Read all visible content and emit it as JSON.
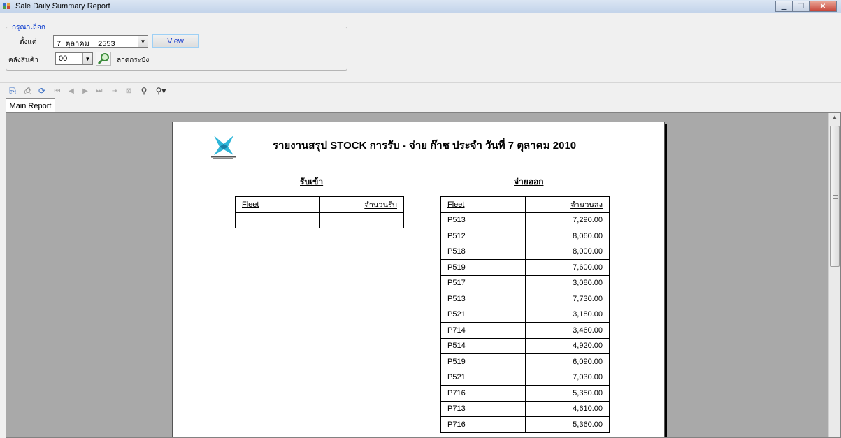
{
  "window": {
    "title": "Sale Daily Summary Report"
  },
  "filter": {
    "group_label": "กรุณาเลือก",
    "from_label": "ตั้งแต่",
    "date_value": "7  ตุลาคม    2553",
    "view_button": "View",
    "warehouse_label": "คลังสินค้า",
    "warehouse_code": "00",
    "warehouse_name": "ลาดกระบัง"
  },
  "tabs": [
    "Main Report"
  ],
  "report": {
    "title": "รายงานสรุป STOCK การรับ - จ่าย ก๊าซ ประจำ วันที่ 7 ตุลาคม 2010",
    "receive": {
      "title": "รับเข้า",
      "headers": [
        "Fleet",
        "จำนวนรับ"
      ],
      "rows": [
        [
          "",
          ""
        ]
      ]
    },
    "issue": {
      "title": "จ่ายออก",
      "headers": [
        "Fleet",
        "จำนวนส่ง"
      ],
      "rows": [
        [
          "P513",
          "7,290.00"
        ],
        [
          "P512",
          "8,060.00"
        ],
        [
          "P518",
          "8,000.00"
        ],
        [
          "P519",
          "7,600.00"
        ],
        [
          "P517",
          "3,080.00"
        ],
        [
          "P513",
          "7,730.00"
        ],
        [
          "P521",
          "3,180.00"
        ],
        [
          "P714",
          "3,460.00"
        ],
        [
          "P514",
          "4,920.00"
        ],
        [
          "P519",
          "6,090.00"
        ],
        [
          "P521",
          "7,030.00"
        ],
        [
          "P716",
          "5,350.00"
        ],
        [
          "P713",
          "4,610.00"
        ],
        [
          "P716",
          "5,360.00"
        ]
      ]
    }
  }
}
